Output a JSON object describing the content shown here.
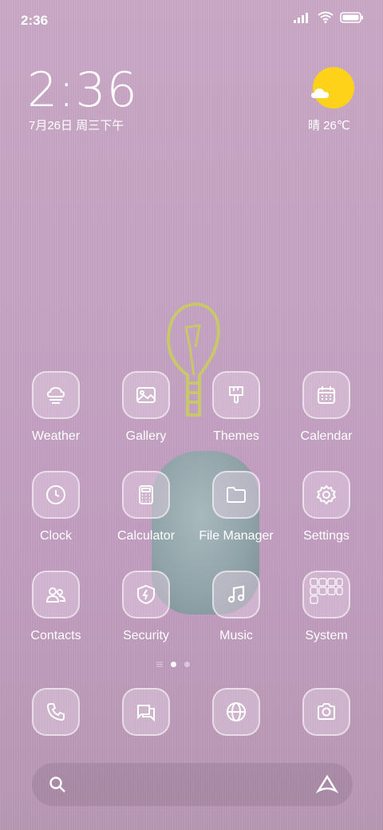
{
  "status_bar": {
    "time": "2:36"
  },
  "clock_widget": {
    "time": "2:36",
    "date": "7月26日 周三下午"
  },
  "weather_widget": {
    "condition_temp": "晴 26℃",
    "icon": "sunny-cloud-icon",
    "sun_color": "#ffd21a"
  },
  "apps": [
    {
      "label": "Weather",
      "icon": "weather-icon"
    },
    {
      "label": "Gallery",
      "icon": "gallery-icon"
    },
    {
      "label": "Themes",
      "icon": "themes-brush-icon"
    },
    {
      "label": "Calendar",
      "icon": "calendar-icon"
    },
    {
      "label": "Clock",
      "icon": "clock-icon"
    },
    {
      "label": "Calculator",
      "icon": "calculator-icon"
    },
    {
      "label": "File Manager",
      "icon": "folder-icon"
    },
    {
      "label": "Settings",
      "icon": "gear-icon"
    },
    {
      "label": "Contacts",
      "icon": "contacts-icon"
    },
    {
      "label": "Security",
      "icon": "shield-icon"
    },
    {
      "label": "Music",
      "icon": "music-note-icon"
    },
    {
      "label": "System",
      "icon": "folder-grid-icon"
    }
  ],
  "page_indicator": {
    "pages": 3,
    "active": 2
  },
  "dock": [
    {
      "icon": "phone-icon"
    },
    {
      "icon": "messages-icon"
    },
    {
      "icon": "browser-globe-icon"
    },
    {
      "icon": "camera-icon"
    }
  ],
  "search_bar": {
    "left_icon": "search-icon",
    "right_icon": "assistant-icon"
  }
}
